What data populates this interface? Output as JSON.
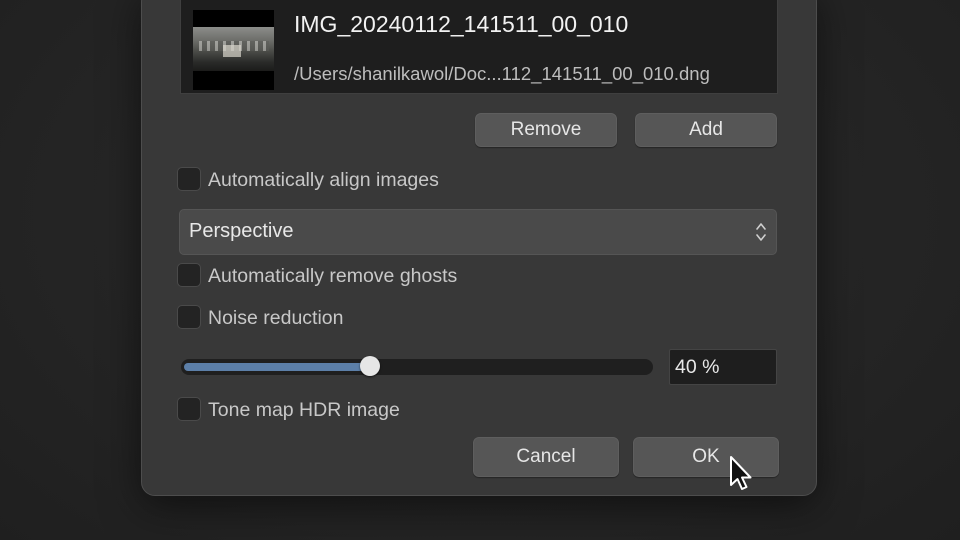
{
  "file": {
    "name": "IMG_20240112_141511_00_010",
    "path": "/Users/shanilkawol/Doc...112_141511_00_010.dng"
  },
  "list_buttons": {
    "remove_label": "Remove",
    "add_label": "Add"
  },
  "options": {
    "auto_align_label": "Automatically align images",
    "auto_align_checked": false,
    "alignment_method": "Perspective",
    "remove_ghosts_label": "Automatically remove ghosts",
    "remove_ghosts_checked": false,
    "noise_reduction_label": "Noise reduction",
    "noise_reduction_checked": false,
    "noise_reduction_value": "40 %",
    "noise_reduction_fraction": 0.4,
    "tone_map_label": "Tone map HDR image",
    "tone_map_checked": false
  },
  "footer": {
    "cancel_label": "Cancel",
    "ok_label": "OK"
  },
  "colors": {
    "slider_accent": "#5c7fa8"
  },
  "icons": {
    "select": "chevron-up-down-icon",
    "pointer": "mouse-pointer-icon"
  }
}
